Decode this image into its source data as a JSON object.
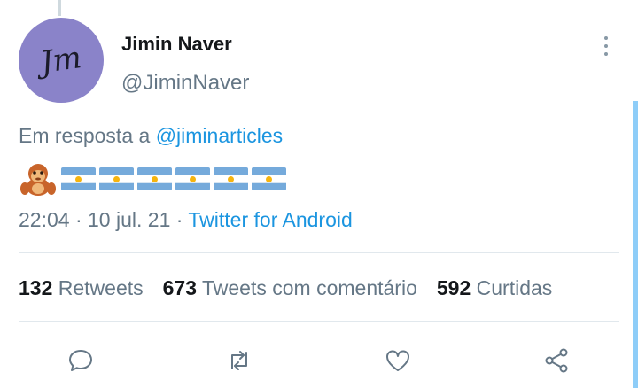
{
  "tweet": {
    "avatar_initials": "Jm",
    "display_name": "Jimin Naver",
    "handle": "@JiminNaver",
    "reply_prefix": "Em resposta a ",
    "reply_mention": "@jiminarticles",
    "emoji": {
      "icons": [
        "monkey-icon",
        "argentina-flag-icon",
        "argentina-flag-icon",
        "argentina-flag-icon",
        "argentina-flag-icon",
        "argentina-flag-icon",
        "argentina-flag-icon"
      ]
    },
    "time": "22:04",
    "date": "10 jul. 21",
    "separator": " · ",
    "source": "Twitter for Android"
  },
  "stats": {
    "retweets_count": "132",
    "retweets_label": " Retweets",
    "quotes_count": "673",
    "quotes_label": " Tweets com comentário",
    "likes_count": "592",
    "likes_label": " Curtidas"
  },
  "actions": [
    "reply-icon",
    "retweet-icon",
    "like-icon",
    "share-icon"
  ],
  "colors": {
    "link": "#1b95e0",
    "muted": "#657786",
    "avatar_bg": "#8a83c9",
    "scrollbar": "#8ecdf8"
  }
}
